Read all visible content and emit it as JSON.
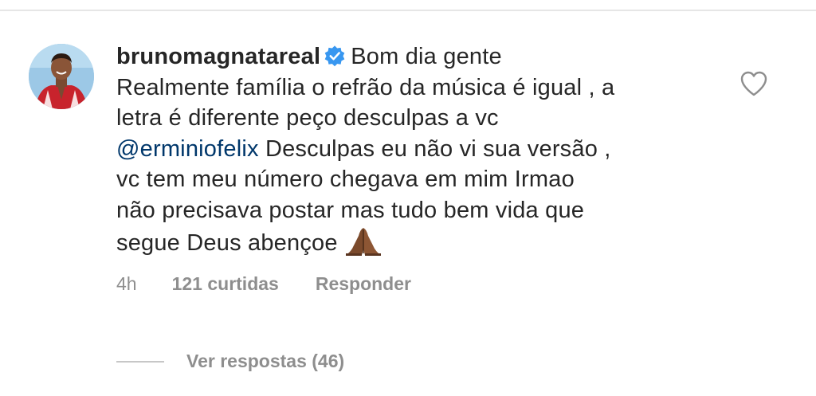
{
  "comment": {
    "username": "brunomagnatareal",
    "verified_icon": "verified-badge-icon",
    "text_intro": "Bom dia gente",
    "text_line_1": "Realmente família o refrão da música é igual , a",
    "text_line_2": "letra é diferente peço desculpas a vc",
    "mention": "@erminiofelix",
    "text_after_mention": " Desculpas eu não vi sua versão ,",
    "text_line_4": "vc tem meu número chegava em mim Irmao",
    "text_line_5": "não precisava postar mas tudo bem vida que",
    "text_line_6": "segue Deus abençoe",
    "emoji_icon": "folded-hands-icon"
  },
  "meta": {
    "time": "4h",
    "likes": "121 curtidas",
    "reply": "Responder"
  },
  "replies": {
    "label": "Ver respostas (46)"
  },
  "like_icon": "heart-outline-icon",
  "colors": {
    "text": "#262626",
    "secondary": "#8e8e8e",
    "mention": "#00376b",
    "verified": "#3897f0"
  }
}
